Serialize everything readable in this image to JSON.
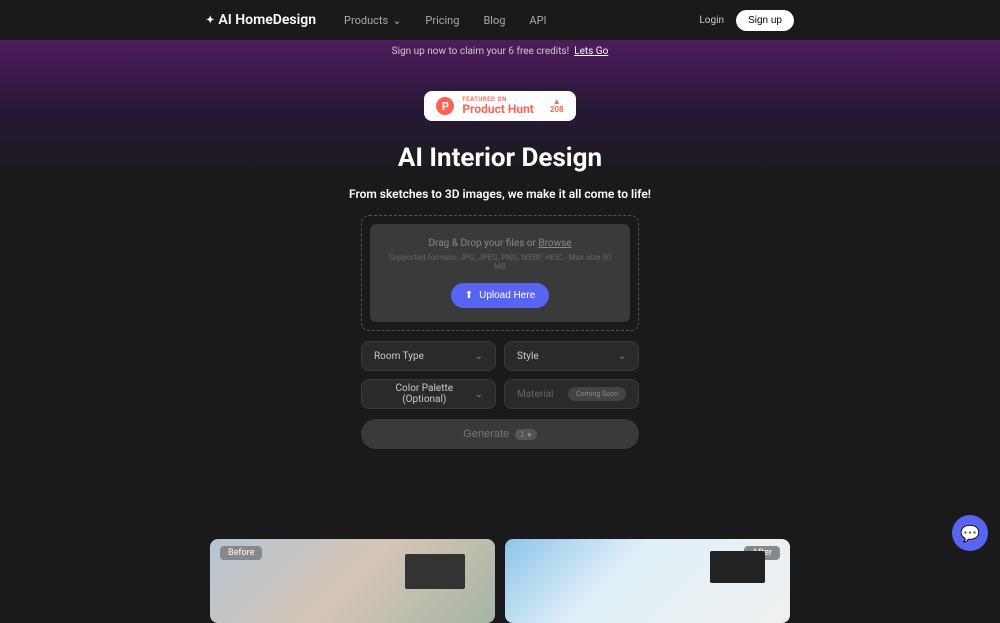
{
  "header": {
    "logo": "AI HomeDesign",
    "nav": {
      "products": "Products",
      "pricing": "Pricing",
      "blog": "Blog",
      "api": "API"
    },
    "login": "Login",
    "signup": "Sign up"
  },
  "banner": {
    "text": "Sign up now to claim your 6 free credits!",
    "link": "Lets Go"
  },
  "product_hunt": {
    "featured": "FEATURED ON",
    "name": "Product Hunt",
    "votes": "208"
  },
  "hero": {
    "title": "AI Interior Design",
    "subtitle": "From sketches to 3D images, we make it all come to life!"
  },
  "upload": {
    "drag_text": "Drag & Drop your files or ",
    "browse": "Browse",
    "formats": "Supported formats: JPG, JPEG, PNG, WEBP, HEIC - Max size 50 MB",
    "button": "Upload Here"
  },
  "controls": {
    "room_type": "Room Type",
    "style": "Style",
    "color_palette": "Color Palette (Optional)",
    "material": "Material",
    "coming_soon": "Coming Soon"
  },
  "generate": {
    "label": "Generate",
    "badge": "1 ●"
  },
  "comparison": {
    "before": "Before",
    "after": "After"
  }
}
